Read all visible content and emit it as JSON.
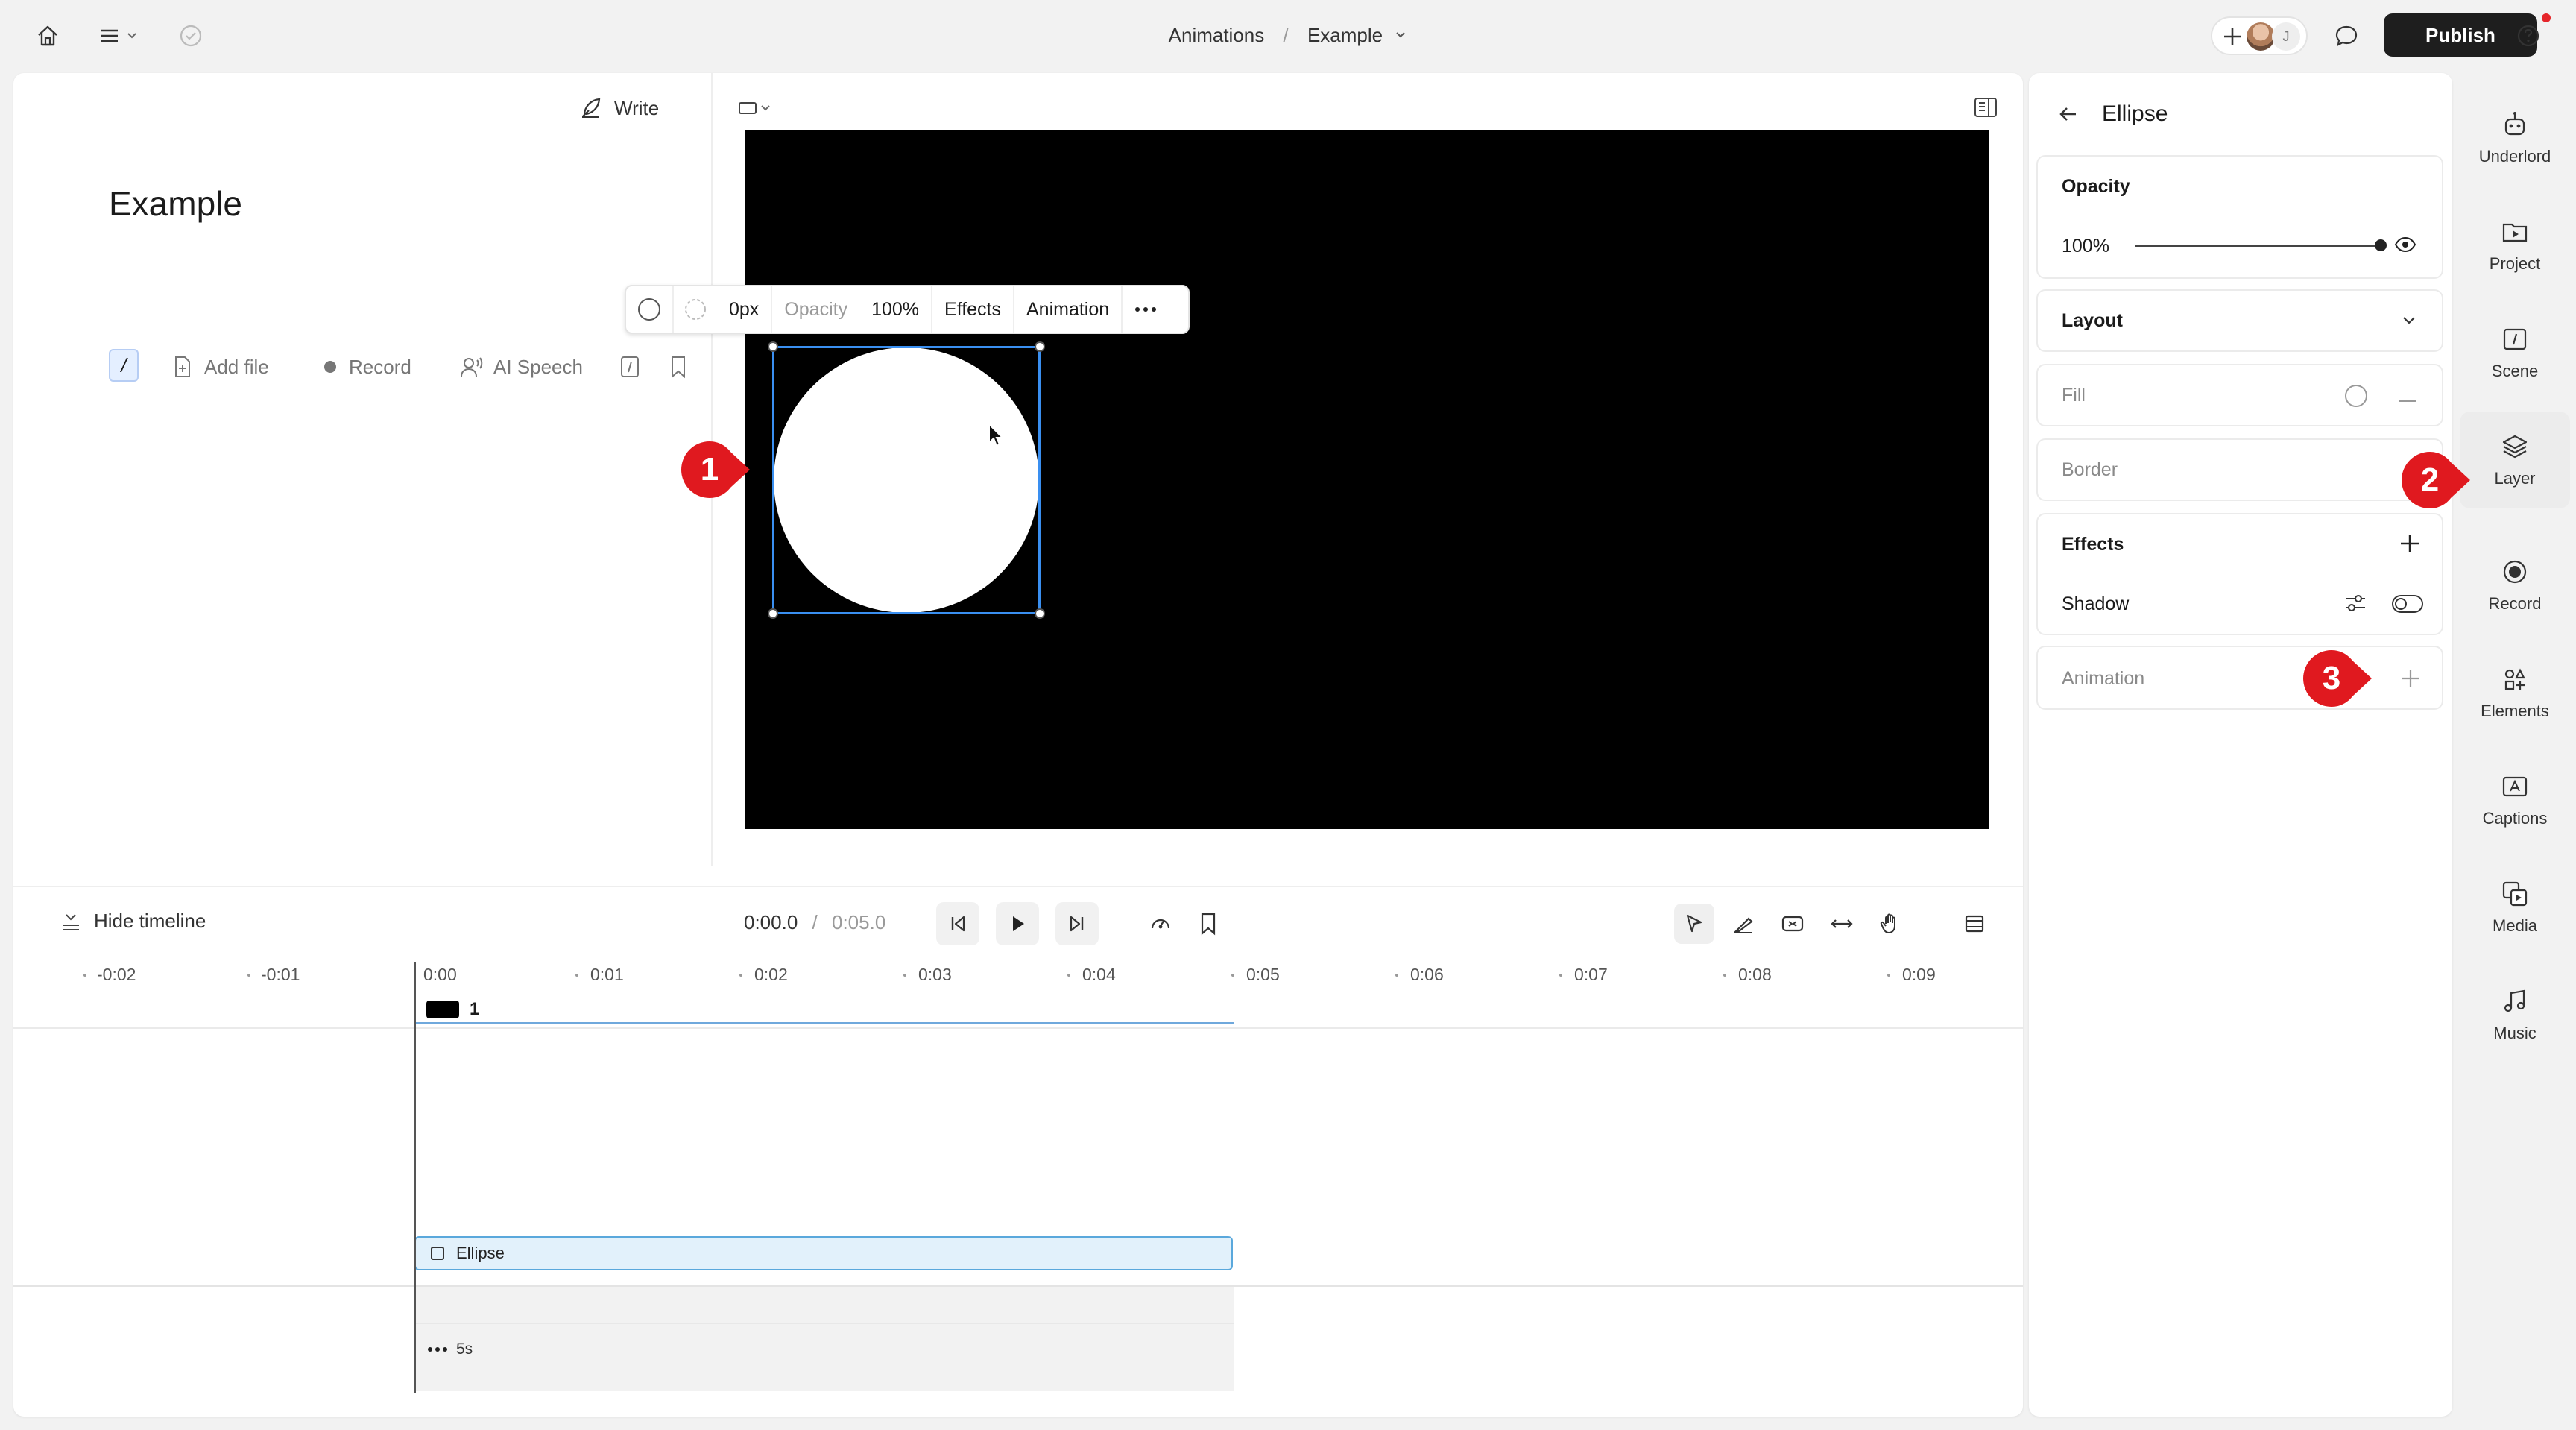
{
  "topbar": {
    "breadcrumb_project": "Animations",
    "breadcrumb_separator": "/",
    "breadcrumb_page": "Example",
    "collaborator_initial": "J",
    "publish_label": "Publish"
  },
  "script": {
    "write_label": "Write",
    "title": "Example",
    "slash_label": "/",
    "tools": {
      "add_file": "Add file",
      "record": "Record",
      "ai_speech": "AI Speech"
    }
  },
  "context_toolbar": {
    "border_width": "0px",
    "opacity_label": "Opacity",
    "opacity_value": "100%",
    "effects_label": "Effects",
    "animation_label": "Animation"
  },
  "timeline": {
    "hide_label": "Hide timeline",
    "current_time": "0:00.0",
    "time_separator": "/",
    "total_time": "0:05.0",
    "ruler_ticks": [
      "-0:02",
      "-0:01",
      "0:00",
      "0:01",
      "0:02",
      "0:03",
      "0:04",
      "0:05",
      "0:06",
      "0:07",
      "0:08",
      "0:09"
    ],
    "scene_number": "1",
    "clip_label": "Ellipse",
    "gap_label": "5s"
  },
  "properties": {
    "title": "Ellipse",
    "opacity_label": "Opacity",
    "opacity_value": "100%",
    "opacity_fraction": 1.0,
    "layout_label": "Layout",
    "fill_label": "Fill",
    "border_label": "Border",
    "effects_label": "Effects",
    "shadow_label": "Shadow",
    "animation_label": "Animation"
  },
  "sidenav": {
    "items": [
      {
        "label": "Underlord",
        "icon": "robot-icon"
      },
      {
        "label": "Project",
        "icon": "folder-play-icon"
      },
      {
        "label": "Scene",
        "icon": "scene-icon"
      },
      {
        "label": "Layer",
        "icon": "layers-icon"
      },
      {
        "label": "Record",
        "icon": "record-icon"
      },
      {
        "label": "Elements",
        "icon": "elements-icon"
      },
      {
        "label": "Captions",
        "icon": "captions-icon"
      },
      {
        "label": "Media",
        "icon": "media-icon"
      },
      {
        "label": "Music",
        "icon": "music-icon"
      }
    ],
    "active": "Layer"
  },
  "annotations": {
    "marker_1": "1",
    "marker_2": "2",
    "marker_3": "3"
  },
  "colors": {
    "accent": "#3a8ff0",
    "marker_red": "#e0191f",
    "clip_fill": "#e2f1fb",
    "publish_bg": "#1e1e1e"
  }
}
